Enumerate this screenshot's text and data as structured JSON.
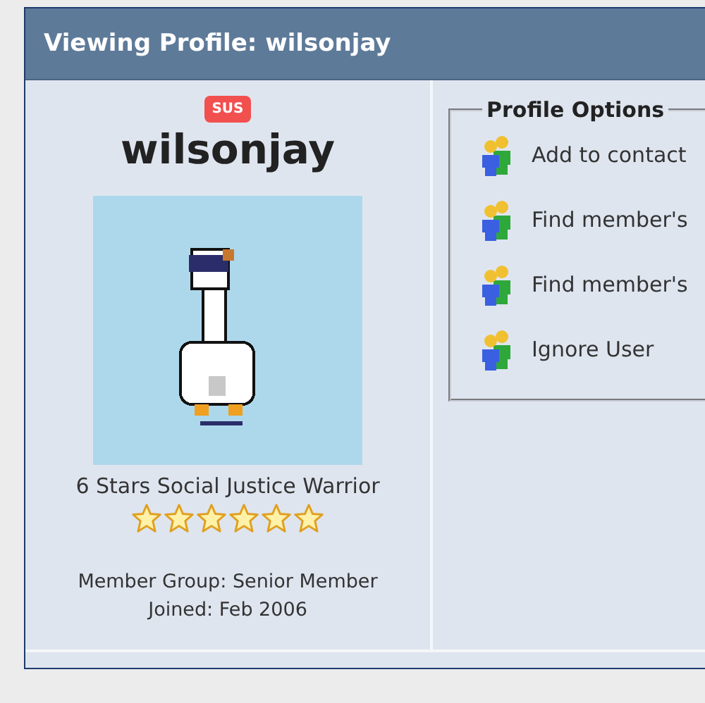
{
  "window": {
    "title": "Viewing Profile: wilsonjay"
  },
  "profile": {
    "badge": "SUS",
    "username": "wilsonjay",
    "rank_title": "6 Stars Social Justice Warrior",
    "stars": 6,
    "member_group": "Member Group: Senior Member",
    "joined": "Joined: Feb 2006"
  },
  "profile_options": {
    "title": "Profile Options",
    "items": [
      {
        "label": "Add to contact"
      },
      {
        "label": "Find member's"
      },
      {
        "label": "Find member's"
      },
      {
        "label": "Ignore User"
      }
    ]
  }
}
